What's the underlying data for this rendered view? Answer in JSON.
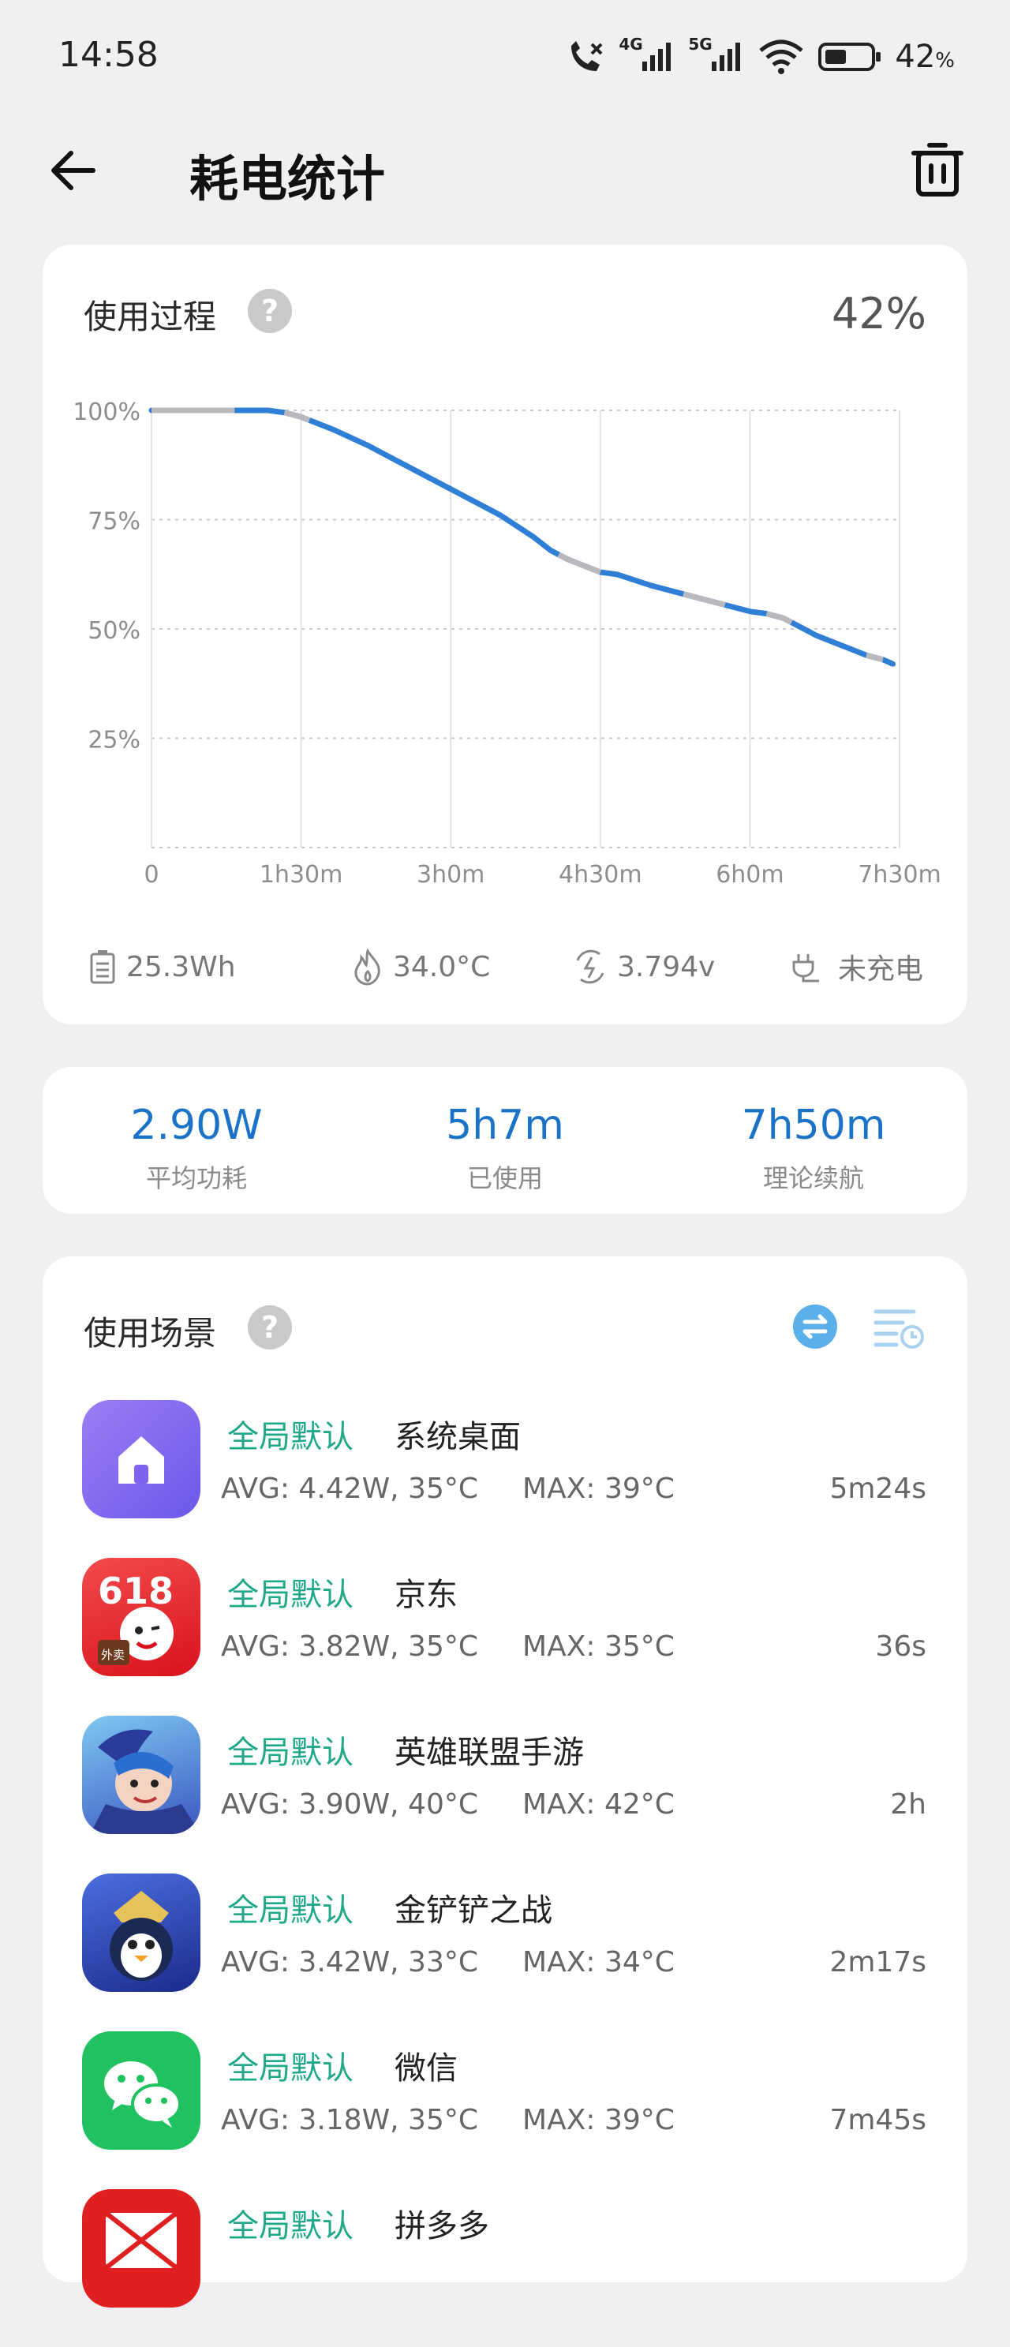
{
  "status": {
    "time": "14:58",
    "battery_percent": "42",
    "battery_unit": "%",
    "net_4g": "4G",
    "net_5g": "5G"
  },
  "header": {
    "title": "耗电统计"
  },
  "process": {
    "title": "使用过程",
    "help": "?",
    "current_percent": "42%"
  },
  "chart_data": {
    "type": "line",
    "title": "",
    "xlabel": "",
    "ylabel": "",
    "x_ticks": [
      "0",
      "1h30m",
      "3h0m",
      "4h30m",
      "6h0m",
      "7h30m"
    ],
    "y_ticks": [
      "25%",
      "50%",
      "75%",
      "100%"
    ],
    "x_unit": "minutes",
    "xlim": [
      0,
      450
    ],
    "ylim": [
      0,
      100
    ],
    "grid": true,
    "series": [
      {
        "color": "#2f7fd6",
        "x": [
          0,
          20,
          40,
          60,
          70,
          80,
          90,
          110,
          130,
          150,
          170,
          190,
          210,
          230,
          240,
          250,
          260,
          270,
          280,
          300,
          320,
          340,
          350,
          360,
          370,
          380,
          390,
          400,
          410,
          420,
          430,
          440,
          446
        ],
        "y": [
          100,
          100,
          100,
          100,
          100,
          99.5,
          98.5,
          95.5,
          92,
          88,
          84,
          80,
          76,
          71,
          68,
          66,
          64.5,
          63,
          62.5,
          60,
          58,
          56,
          55,
          54,
          53.5,
          52.5,
          50.5,
          48.5,
          47,
          45.5,
          44,
          43,
          42
        ]
      }
    ],
    "idle_segments": [
      [
        0,
        50
      ],
      [
        80,
        95
      ],
      [
        245,
        270
      ],
      [
        320,
        345
      ],
      [
        370,
        385
      ],
      [
        430,
        440
      ]
    ],
    "idle_color": "#b9b9bd"
  },
  "battery_stats": {
    "capacity": "25.3Wh",
    "temperature": "34.0°C",
    "voltage": "3.794v",
    "charging": "未充电"
  },
  "summary": [
    {
      "value": "2.90W",
      "label": "平均功耗"
    },
    {
      "value": "5h7m",
      "label": "已使用"
    },
    {
      "value": "7h50m",
      "label": "理论续航"
    }
  ],
  "scenes": {
    "title": "使用场景",
    "help": "?",
    "apps": [
      {
        "tag": "全局默认",
        "name": "系统桌面",
        "avg": "AVG: 4.42W, 35°C",
        "max": "MAX:  39°C",
        "time": "5m24s",
        "icon": "home-icon",
        "icon_color": "#8a6cf2"
      },
      {
        "tag": "全局默认",
        "name": "京东",
        "avg": "AVG: 3.82W, 35°C",
        "max": "MAX:  35°C",
        "time": "36s",
        "icon": "jd-618-icon",
        "icon_color": "#e8232c",
        "icon_text": "618",
        "icon_badge": "外卖"
      },
      {
        "tag": "全局默认",
        "name": "英雄联盟手游",
        "avg": "AVG: 3.90W, 40°C",
        "max": "MAX:  42°C",
        "time": "2h",
        "icon": "lol-mobile-icon",
        "icon_color": "#3f5fc8"
      },
      {
        "tag": "全局默认",
        "name": "金铲铲之战",
        "avg": "AVG: 3.42W, 33°C",
        "max": "MAX:  34°C",
        "time": "2m17s",
        "icon": "golden-spatula-icon",
        "icon_color": "#2c3fb0"
      },
      {
        "tag": "全局默认",
        "name": "微信",
        "avg": "AVG: 3.18W, 35°C",
        "max": "MAX:  39°C",
        "time": "7m45s",
        "icon": "wechat-icon",
        "icon_color": "#1fc160"
      },
      {
        "tag": "全局默认",
        "name": "拼多多",
        "avg": "",
        "max": "",
        "time": "",
        "icon": "pinduoduo-icon",
        "icon_color": "#e02020"
      }
    ]
  }
}
